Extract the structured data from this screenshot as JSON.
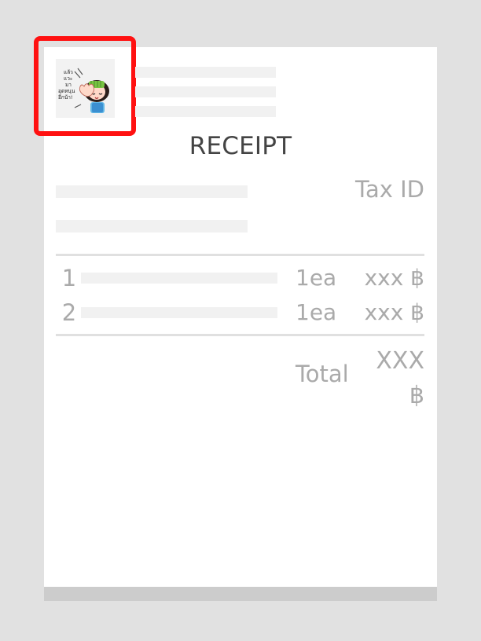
{
  "receipt": {
    "title": "RECEIPT",
    "tax_id_label": "Tax ID",
    "line_items": [
      {
        "index": "1",
        "qty": "1ea",
        "amount": "xxx ฿"
      },
      {
        "index": "2",
        "qty": "1ea",
        "amount": "xxx ฿"
      }
    ],
    "total_label": "Total",
    "total_value": "XXX ฿"
  },
  "logo": {
    "icon": "mascot-sticker-icon",
    "text": "แล้ว\nแวะ\nมา\nอุดหนุน\nอีกน้า!"
  },
  "colors": {
    "background": "#e1e1e1",
    "paper": "#ffffff",
    "highlight": "#ff1111",
    "muted_text": "#aaaaaa",
    "title_text": "#444444"
  }
}
